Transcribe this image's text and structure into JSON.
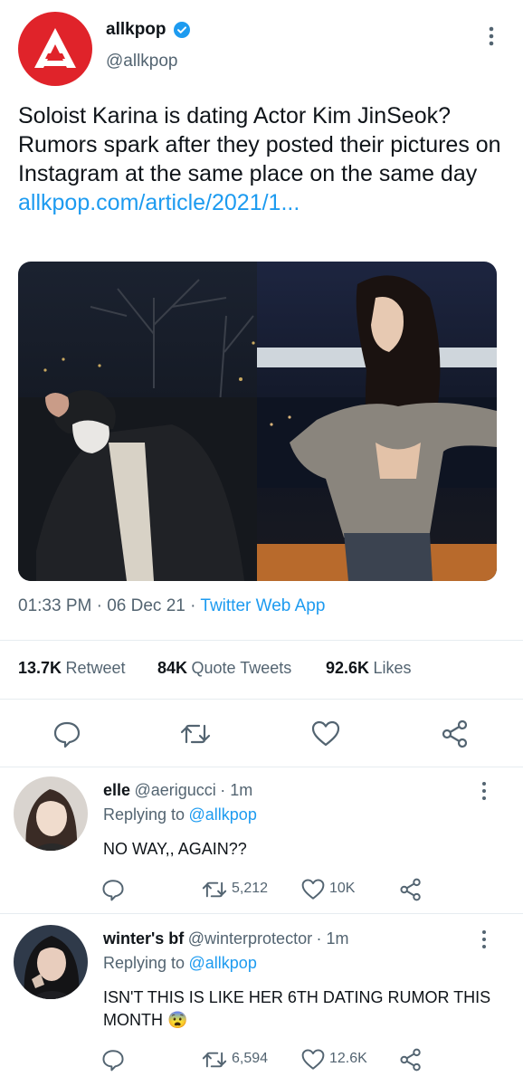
{
  "header": {
    "name": "allkpop",
    "handle": "@allkpop"
  },
  "tweet": {
    "text": "Soloist Karina is dating Actor Kim JinSeok? Rumors spark after they posted their pictures on Instagram at the same place on the same day",
    "link": "allkpop.com/article/2021/1...",
    "time": "01:33 PM",
    "date": "06 Dec 21",
    "source": "Twitter Web App"
  },
  "stats": {
    "retweets": "13.7K",
    "retweets_label": "Retweet",
    "quotes": "84K",
    "quotes_label": "Quote Tweets",
    "likes": "92.6K",
    "likes_label": "Likes"
  },
  "replies": [
    {
      "name": "elle",
      "handle": "@aerigucci",
      "time": "1m",
      "replying_prefix": "Replying to",
      "replying_to": "@allkpop",
      "text": "NO WAY,, AGAIN??",
      "retweets": "5,212",
      "likes": "10K"
    },
    {
      "name": "winter's bf",
      "handle": "@winterprotector",
      "time": "1m",
      "replying_prefix": "Replying to",
      "replying_to": "@allkpop",
      "text": "ISN'T THIS IS LIKE HER 6TH DATING RUMOR THIS MONTH",
      "emoji": "😨",
      "retweets": "6,594",
      "likes": "12.6K"
    }
  ],
  "colors": {
    "accent": "#1d9bf0",
    "brand_red": "#e0232a",
    "verified": "#1d9bf0"
  }
}
